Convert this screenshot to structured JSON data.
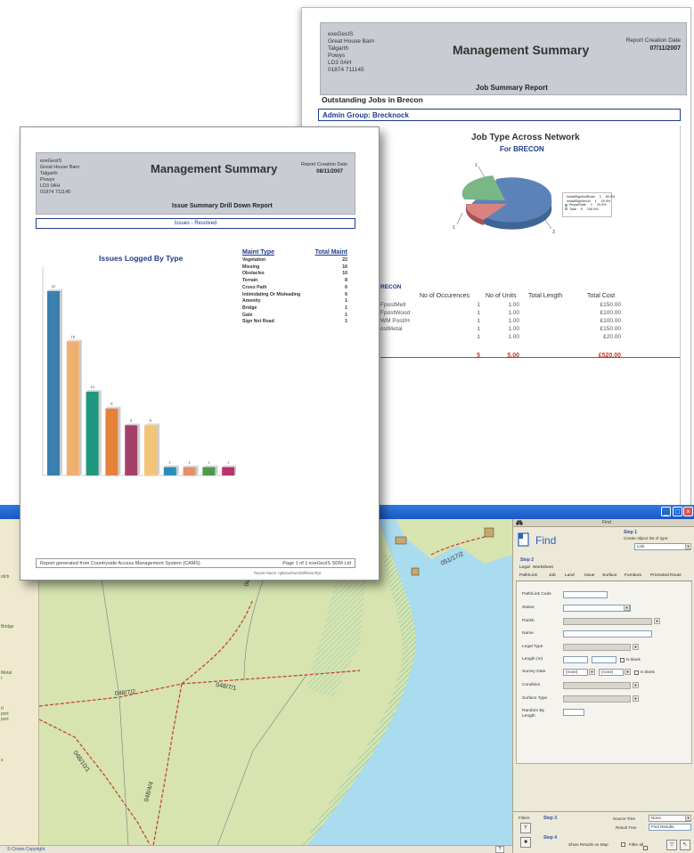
{
  "back_report": {
    "company_lines": "exeGesIS\nGreat House Barn\nTalgarth\nPowys\nLD3 0AH\n01874 711145",
    "title": "Management Summary",
    "creation_label": "Report Creation Date",
    "creation_date": "07/11/2007",
    "subtitle": "Job Summary Report",
    "outstanding": "Outstanding Jobs in Brecon",
    "admin_group": "Admin Group: Brecknock",
    "chart_title": "Job Type Across Network",
    "chart_subtitle": "For BRECON",
    "pie_labels": [
      "1",
      "1",
      "3"
    ],
    "legend_rows": [
      {
        "name": "InstallSignNotRoad",
        "count": "3",
        "pct": "60.0%",
        "color": "#5b83b8"
      },
      {
        "name": "InstallSignWood",
        "count": "1",
        "pct": "20.0%",
        "color": "#d9827f"
      },
      {
        "name": "RepairGate",
        "count": "1",
        "pct": "20.0%",
        "color": "#79b884"
      },
      {
        "name": "Total",
        "count": "5",
        "pct": "100.0%",
        "color": "#ffffff"
      }
    ],
    "table_section_label": "RECON",
    "table_headers": [
      "No of Occurences",
      "No of Units",
      "Total Length",
      "Total Cost"
    ],
    "table_rows": [
      {
        "type": "FpostMetl",
        "occ": "1",
        "units": "1.00",
        "cost": "£150.00"
      },
      {
        "type": "FpostWood",
        "occ": "1",
        "units": "1.00",
        "cost": "£100.00"
      },
      {
        "type": "WM Post/H",
        "occ": "1",
        "units": "1.00",
        "cost": "£100.00"
      },
      {
        "type": "ostMetal",
        "occ": "1",
        "units": "1.00",
        "cost": "£150.00"
      },
      {
        "type": "",
        "occ": "1",
        "units": "1.00",
        "cost": "£20.00"
      }
    ],
    "totals": {
      "occ": "5",
      "units": "5.00",
      "cost": "£520.00"
    }
  },
  "front_report": {
    "company_lines": "exeGesIS\nGreat House Barn\nTalgarth\nPowys\nLD3 0AH\n01874 711145",
    "title": "Management Summary",
    "creation_label": "Report Creation Date",
    "creation_date": "08/11/2007",
    "subtitle": "Issue Summary Drill Down Report",
    "issues_bar": "Issues - Resolved",
    "footer_left": "Report generated from Countryside Access Management System (CAMS)",
    "footer_right": "Page 1 of 1   exeGesIS SDM Ltd",
    "report_name": "Report Name: rgtIssueSumDrillDownRpt"
  },
  "chart_data": {
    "type": "bar",
    "title": "Issues Logged By Type",
    "categories": [
      "Vegetation",
      "Missing",
      "Obstacles",
      "Terrain",
      "Cross Path",
      "Intimidating Or Misleading",
      "Amenity",
      "Bridge",
      "Gate",
      "Sign Not Road"
    ],
    "values": [
      22,
      16,
      10,
      8,
      6,
      6,
      1,
      1,
      1,
      1
    ],
    "colors": [
      "#3a7fb0",
      "#efb06f",
      "#20977f",
      "#e5823a",
      "#a4416b",
      "#f3c57a",
      "#2a8fb8",
      "#e58f6a",
      "#4e9a4d",
      "#b9336a"
    ],
    "ylim": [
      0,
      24
    ],
    "table_headers": [
      "Maint Type",
      "Total Maint"
    ]
  },
  "gis": {
    "left_links": [
      "otch",
      "Bridge",
      "Metal\nr",
      "rt\nport\nport",
      "s"
    ],
    "copyright": "© Crown Copyright",
    "help_label": "?",
    "map_labels": [
      "048/7/2",
      "048/7/1",
      "048/10/1",
      "048/4/4",
      "051/17/2",
      "048"
    ]
  },
  "find_panel": {
    "bar_title": "Find",
    "title": "Find",
    "step1_label": "Step 1",
    "step1_text": "Create object list of type:",
    "object_type": "Link",
    "step2_label": "Step 2",
    "tabs_row1": [
      "Legal",
      "Worksheet"
    ],
    "tabs_row2": [
      "Path/Link",
      "Job",
      "Land",
      "Issue",
      "Surface",
      "Furniture",
      "Promoted Route"
    ],
    "fields": [
      "Path/Link Code",
      "Status",
      "Parish",
      "Name",
      "Legal Type",
      "Length (m)",
      "Survey Date",
      "Condition",
      "Surface Type",
      "Random By Length"
    ],
    "is_blank": "Is blank",
    "survey_none": "(none)",
    "step3_label": "Step 3",
    "step4_label": "Step 4",
    "filters_label": "Filters",
    "source_tree_label": "Source Tree",
    "source_tree_value": "None",
    "result_tree_label": "Result Tree",
    "result_tree_value": "Find Results",
    "show_results_label": "Show Results on Map",
    "filter_all_label": "Filter all"
  }
}
